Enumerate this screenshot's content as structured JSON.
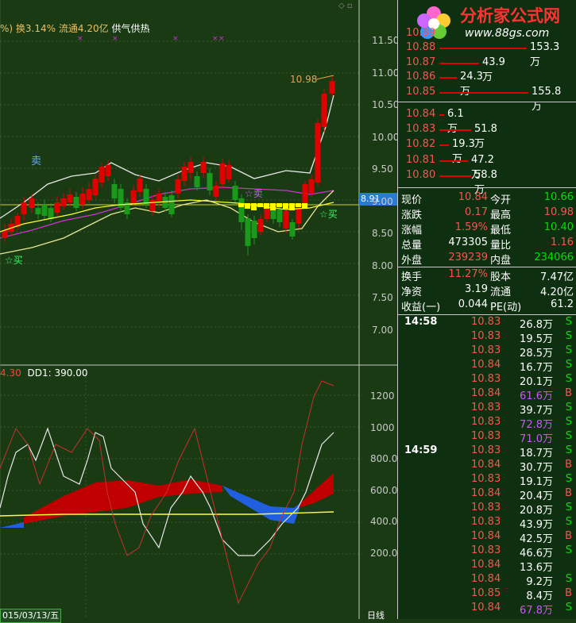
{
  "top_info": {
    "percent_prefix": "%)",
    "turnover": "换3.14%",
    "float": "流通4.20亿",
    "signal": "供气供热"
  },
  "price_axis": [
    "11.50",
    "11.00",
    "10.50",
    "10.00",
    "9.50",
    "9.00",
    "8.50",
    "8.00",
    "7.50",
    "7.00"
  ],
  "price_marker": "8.91",
  "peak_label": "10.98",
  "tags": {
    "sell": "卖",
    "sell_star": "☆卖",
    "buy1": "☆买",
    "buy2": "☆买"
  },
  "indicator": {
    "label_a": "4.30",
    "label_b": "DD1: 390.00"
  },
  "ind_axis": [
    "1200",
    "1000",
    "800.0",
    "600.0",
    "400.0",
    "200.0"
  ],
  "bottom": {
    "date": "015/03/13/五",
    "period": "日线"
  },
  "logo": {
    "name": "分析家公式网",
    "url": "www.88gs.com",
    "partial_top": "10.89"
  },
  "order_book": {
    "asks": [
      {
        "price": "10.88",
        "vol": "153.3万"
      },
      {
        "price": "10.87",
        "vol": "43.9万"
      },
      {
        "price": "10.86",
        "vol": "24.3万"
      },
      {
        "price": "10.85",
        "vol": "155.8万"
      }
    ],
    "bids": [
      {
        "price": "10.84",
        "vol": "6.1万"
      },
      {
        "price": "10.83",
        "vol": "51.8万"
      },
      {
        "price": "10.82",
        "vol": "19.3万"
      },
      {
        "price": "10.81",
        "vol": "47.2万"
      },
      {
        "price": "10.80",
        "vol": "58.8万"
      }
    ]
  },
  "quote": [
    {
      "l1": "现价",
      "v1": "10.84",
      "l2": "今开",
      "v2": "10.66"
    },
    {
      "l1": "涨跌",
      "v1": "0.17",
      "l2": "最高",
      "v2": "10.98"
    },
    {
      "l1": "涨幅",
      "v1": "1.59%",
      "l2": "最低",
      "v2": "10.40"
    },
    {
      "l1": "总量",
      "v1": "473305",
      "l2": "量比",
      "v2": "1.16"
    },
    {
      "l1": "外盘",
      "v1": "239239",
      "l2": "内盘",
      "v2": "234066"
    },
    {
      "l1": "换手",
      "v1": "11.27%",
      "l2": "股本",
      "v2": "7.47亿"
    },
    {
      "l1": "净资",
      "v1": "3.19",
      "l2": "流通",
      "v2": "4.20亿"
    },
    {
      "l1": "收益(一)",
      "v1": "0.044",
      "l2": "PE(动)",
      "v2": "61.2"
    }
  ],
  "ticks_1458": {
    "time": "14:58",
    "rows": [
      {
        "p": "10.83",
        "v": "26.8万",
        "s": "S"
      },
      {
        "p": "10.83",
        "v": "19.5万",
        "s": "S"
      },
      {
        "p": "10.83",
        "v": "28.5万",
        "s": "S"
      },
      {
        "p": "10.84",
        "v": "16.7万",
        "s": "S"
      },
      {
        "p": "10.83",
        "v": "20.1万",
        "s": "S"
      },
      {
        "p": "10.84",
        "v": "61.6万",
        "s": "B"
      },
      {
        "p": "10.83",
        "v": "39.7万",
        "s": "S"
      },
      {
        "p": "10.83",
        "v": "72.8万",
        "s": "S"
      },
      {
        "p": "10.83",
        "v": "71.0万",
        "s": "S"
      }
    ]
  },
  "ticks_1459": {
    "time": "14:59",
    "rows": [
      {
        "p": "10.83",
        "v": "18.7万",
        "s": "S"
      },
      {
        "p": "10.84",
        "v": "30.7万",
        "s": "B"
      },
      {
        "p": "10.83",
        "v": "19.1万",
        "s": "S"
      },
      {
        "p": "10.84",
        "v": "20.4万",
        "s": "B"
      },
      {
        "p": "10.83",
        "v": "20.8万",
        "s": "S"
      },
      {
        "p": "10.83",
        "v": "43.9万",
        "s": "S"
      },
      {
        "p": "10.84",
        "v": "42.5万",
        "s": "B"
      },
      {
        "p": "10.83",
        "v": "46.6万",
        "s": "S"
      },
      {
        "p": "10.84",
        "v": "13.6万",
        "s": ""
      },
      {
        "p": "10.84",
        "v": "9.2万",
        "s": "S"
      },
      {
        "p": "10.85",
        "v": "8.4万",
        "s": "B"
      },
      {
        "p": "10.84",
        "v": "67.8万",
        "s": "S"
      }
    ]
  },
  "colors": {
    "up": "#e00000",
    "down": "#1a9a1a",
    "purple": "#cc33cc",
    "yellow": "#ffff33",
    "white": "#e8e8e8",
    "text_red": "#ff5050",
    "text_green": "#00e000",
    "gray": "#c8c8c8"
  }
}
